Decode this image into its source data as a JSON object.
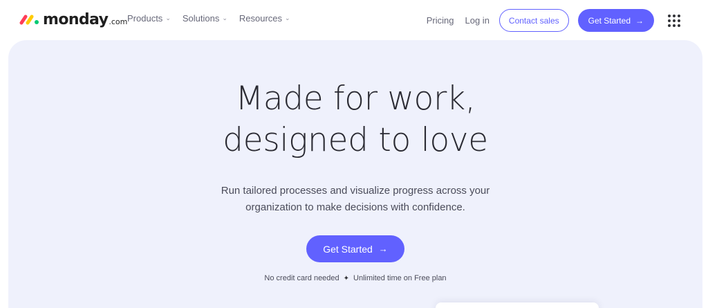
{
  "brand": {
    "name": "monday",
    "suffix": ".com",
    "colors": {
      "primary": "#6161ff",
      "logo_red": "#ff3d57",
      "logo_yellow": "#ffcb00",
      "logo_green": "#00ca72",
      "hero_bg": "#eff1fc"
    }
  },
  "nav": {
    "items": [
      {
        "label": "Products",
        "icon": "chevron-down-icon"
      },
      {
        "label": "Solutions",
        "icon": "chevron-down-icon"
      },
      {
        "label": "Resources",
        "icon": "chevron-down-icon"
      }
    ],
    "pricing": "Pricing",
    "login": "Log in",
    "contact_sales": "Contact sales",
    "get_started": "Get Started",
    "apps_icon": "grid-dots-icon"
  },
  "hero": {
    "headline": [
      "Made for work,",
      "designed to love"
    ],
    "subtext": [
      "Run tailored processes and visualize progress across your",
      "organization to make decisions with confidence."
    ],
    "cta": "Get Started",
    "cta_icon": "arrow-right-icon",
    "note_left": "No credit card needed",
    "note_separator_icon": "sparkle-icon",
    "note_right": "Unlimited time on Free plan"
  }
}
